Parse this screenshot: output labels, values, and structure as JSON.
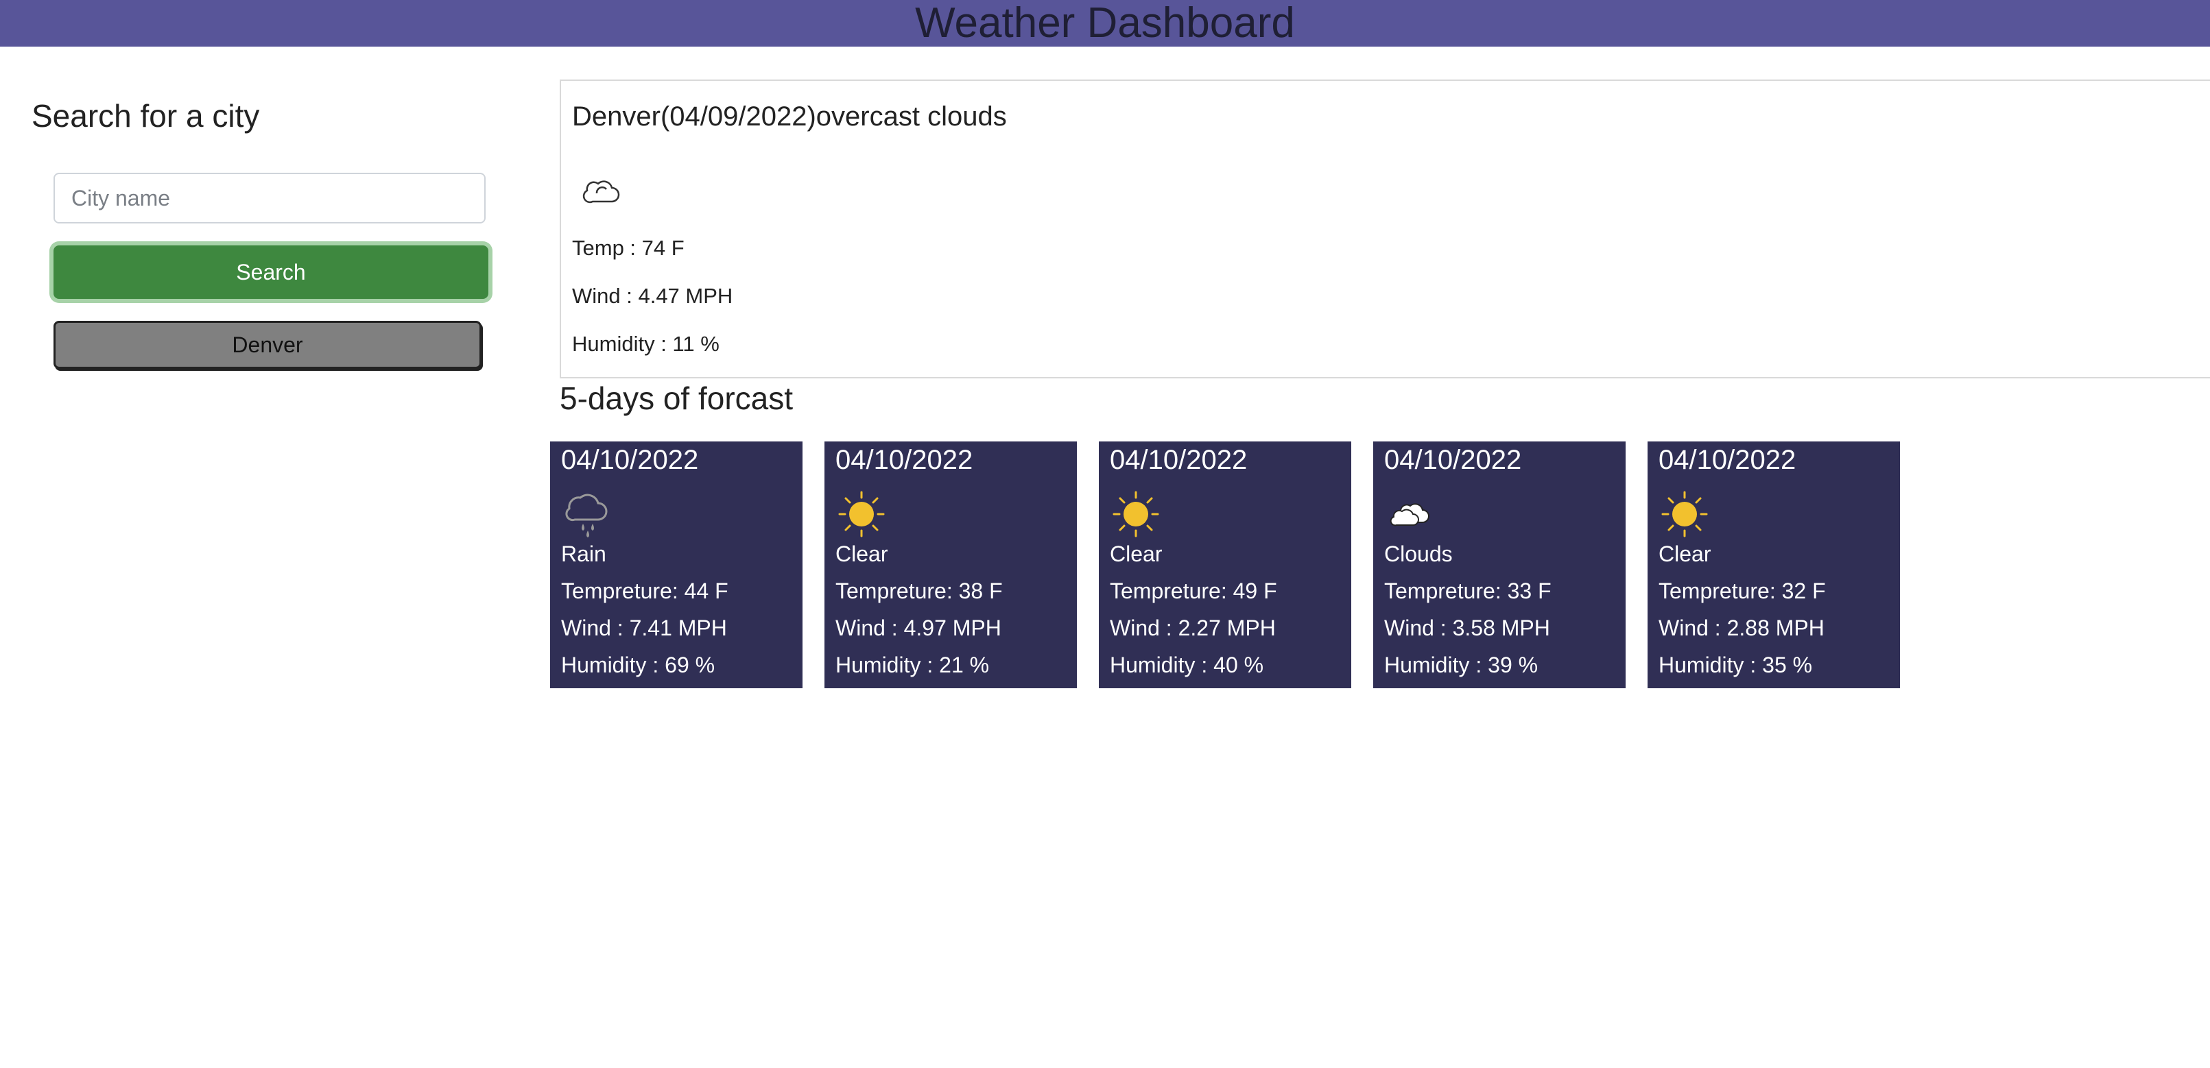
{
  "header": {
    "title": "Weather Dashboard"
  },
  "sidebar": {
    "title": "Search for a city",
    "input_placeholder": "City name",
    "input_value": "",
    "search_label": "Search",
    "history": [
      "Denver"
    ]
  },
  "current": {
    "title": "Denver(04/09/2022)overcast clouds",
    "icon": "cloud-outline-icon",
    "temp": "Temp : 74 F",
    "wind": "Wind : 4.47 MPH",
    "humidity": "Humidity : 11 %"
  },
  "forecast": {
    "title": "5-days of forcast",
    "days": [
      {
        "date": "04/10/2022",
        "icon": "rain-cloud-icon",
        "condition": "Rain",
        "temp": "Tempreture: 44 F",
        "wind": "Wind : 7.41 MPH",
        "humidity": "Humidity : 69 %"
      },
      {
        "date": "04/10/2022",
        "icon": "sun-icon",
        "condition": "Clear",
        "temp": "Tempreture: 38 F",
        "wind": "Wind : 4.97 MPH",
        "humidity": "Humidity : 21 %"
      },
      {
        "date": "04/10/2022",
        "icon": "sun-icon",
        "condition": "Clear",
        "temp": "Tempreture: 49 F",
        "wind": "Wind : 2.27 MPH",
        "humidity": "Humidity : 40 %"
      },
      {
        "date": "04/10/2022",
        "icon": "cloud-icon",
        "condition": "Clouds",
        "temp": "Tempreture: 33 F",
        "wind": "Wind : 3.58 MPH",
        "humidity": "Humidity : 39 %"
      },
      {
        "date": "04/10/2022",
        "icon": "sun-icon",
        "condition": "Clear",
        "temp": "Tempreture: 32 F",
        "wind": "Wind : 2.88 MPH",
        "humidity": "Humidity : 35 %"
      }
    ]
  },
  "colors": {
    "header": "#585599",
    "card": "#302f55",
    "search_button": "#3e883f",
    "history_button": "#808080",
    "sun": "#f2c12e"
  }
}
